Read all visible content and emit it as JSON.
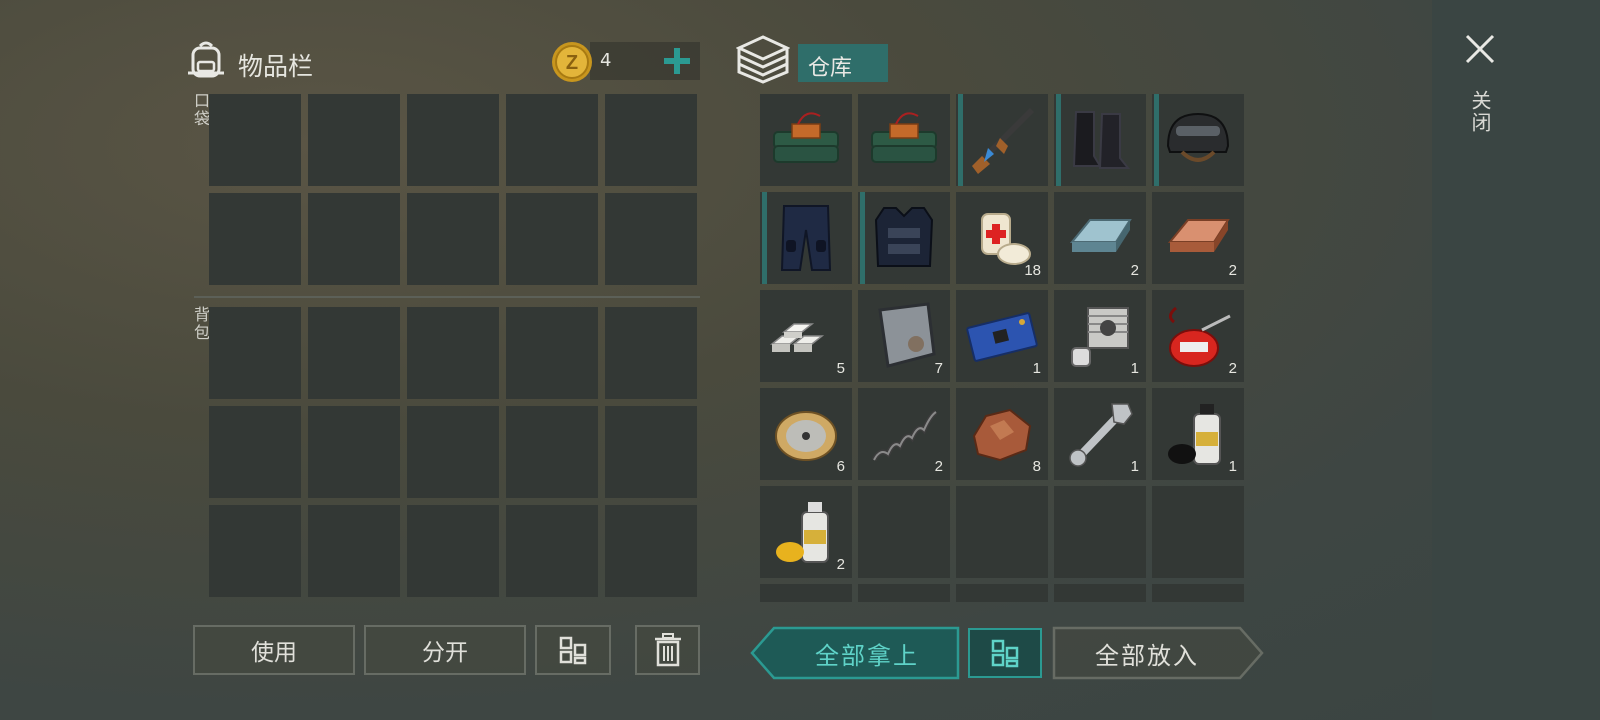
{
  "inventory": {
    "title": "物品栏",
    "coin_count": "4",
    "pocket_label": "口袋",
    "backpack_label": "背包"
  },
  "storage": {
    "title": "仓库",
    "items": [
      {
        "name": "c4-explosive",
        "count": "",
        "equip": false
      },
      {
        "name": "c4-explosive",
        "count": "",
        "equip": false
      },
      {
        "name": "ak-rifle",
        "count": "",
        "equip": true
      },
      {
        "name": "combat-boots",
        "count": "",
        "equip": true
      },
      {
        "name": "combat-helmet",
        "count": "",
        "equip": true
      },
      {
        "name": "tactical-pants",
        "count": "",
        "equip": true
      },
      {
        "name": "police-vest",
        "count": "",
        "equip": true
      },
      {
        "name": "bandage",
        "count": "18",
        "equip": false
      },
      {
        "name": "steel-ingot",
        "count": "2",
        "equip": false
      },
      {
        "name": "copper-ingot",
        "count": "2",
        "equip": false
      },
      {
        "name": "aluminum-bars",
        "count": "5",
        "equip": false
      },
      {
        "name": "metal-plate",
        "count": "7",
        "equip": false
      },
      {
        "name": "circuit-board",
        "count": "1",
        "equip": false
      },
      {
        "name": "engine-cylinder",
        "count": "1",
        "equip": false
      },
      {
        "name": "oil-can",
        "count": "2",
        "equip": false
      },
      {
        "name": "wire-spool",
        "count": "6",
        "equip": false
      },
      {
        "name": "spring",
        "count": "2",
        "equip": false
      },
      {
        "name": "copper-ore",
        "count": "8",
        "equip": false
      },
      {
        "name": "wrench",
        "count": "1",
        "equip": false
      },
      {
        "name": "spray-paint-black",
        "count": "1",
        "equip": false
      },
      {
        "name": "spray-paint-yellow",
        "count": "2",
        "equip": false
      }
    ]
  },
  "buttons": {
    "use": "使用",
    "split": "分开",
    "take_all": "全部拿上",
    "put_all": "全部放入"
  },
  "close_label": "关闭",
  "colors": {
    "accent": "#2b8f88",
    "slot": "#333835",
    "equip_marker": "#2f6e6a"
  }
}
